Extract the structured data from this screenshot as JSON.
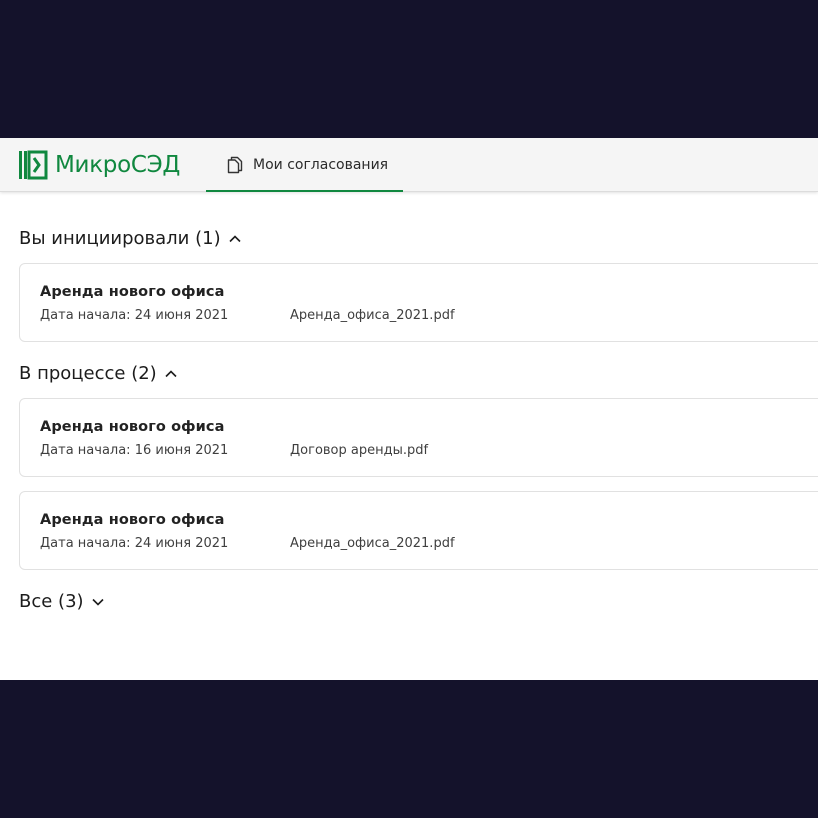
{
  "header": {
    "logo_text": "МикроСЭД",
    "logo_icon": "microsed-logo-icon",
    "brand_color": "#10883f",
    "nav_tab": {
      "label": "Мои согласования",
      "icon": "documents-icon",
      "active": true
    }
  },
  "sections": [
    {
      "title": "Вы инициировали (1)",
      "expanded": true,
      "items": [
        {
          "title": "Аренда нового офиса",
          "date": "Дата начала: 24 июня 2021",
          "file": "Аренда_офиса_2021.pdf"
        }
      ]
    },
    {
      "title": "В процессе (2)",
      "expanded": true,
      "items": [
        {
          "title": "Аренда нового офиса",
          "date": "Дата начала: 16 июня 2021",
          "file": "Договор аренды.pdf"
        },
        {
          "title": "Аренда нового офиса",
          "date": "Дата начала: 24 июня 2021",
          "file": "Аренда_офиса_2021.pdf"
        }
      ]
    },
    {
      "title": "Все (3)",
      "expanded": false,
      "items": []
    }
  ],
  "colors": {
    "background": "#14122b",
    "accent": "#10883f"
  }
}
